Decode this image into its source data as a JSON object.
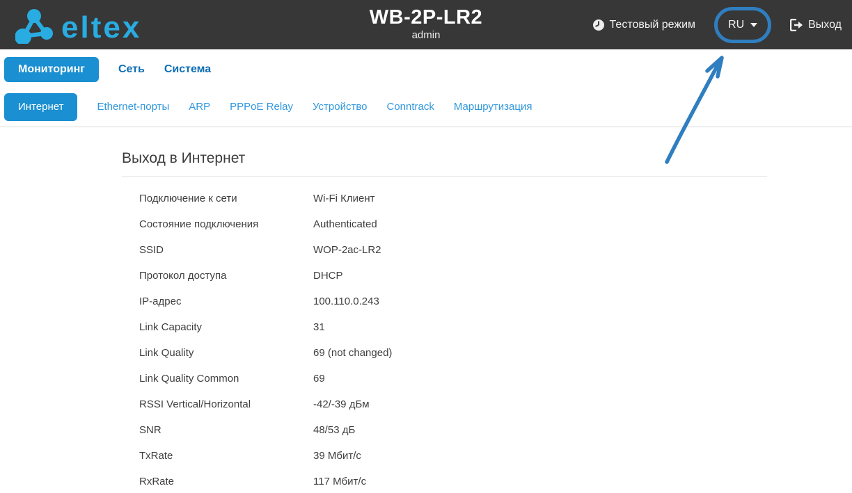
{
  "header": {
    "brand": "eltex",
    "title": "WB-2P-LR2",
    "subtitle": "admin",
    "test_mode_label": "Тестовый режим",
    "language_label": "RU",
    "logout_label": "Выход"
  },
  "nav": {
    "items": [
      {
        "label": "Мониторинг",
        "active": true
      },
      {
        "label": "Сеть",
        "active": false
      },
      {
        "label": "Система",
        "active": false
      }
    ]
  },
  "subnav": {
    "items": [
      {
        "label": "Интернет",
        "active": true
      },
      {
        "label": "Ethernet-порты",
        "active": false
      },
      {
        "label": "ARP",
        "active": false
      },
      {
        "label": "PPPoE Relay",
        "active": false
      },
      {
        "label": "Устройство",
        "active": false
      },
      {
        "label": "Conntrack",
        "active": false
      },
      {
        "label": "Маршрутизация",
        "active": false
      }
    ]
  },
  "main": {
    "heading": "Выход в Интернет",
    "rows": [
      {
        "label": "Подключение к сети",
        "value": "Wi-Fi Клиент"
      },
      {
        "label": "Состояние подключения",
        "value": "Authenticated"
      },
      {
        "label": "SSID",
        "value": "WOP-2ac-LR2"
      },
      {
        "label": "Протокол доступа",
        "value": "DHCP"
      },
      {
        "label": "IP-адрес",
        "value": "100.110.0.243"
      },
      {
        "label": "Link Capacity",
        "value": "31"
      },
      {
        "label": "Link Quality",
        "value": "69 (not changed)"
      },
      {
        "label": "Link Quality Common",
        "value": "69"
      },
      {
        "label": "RSSI Vertical/Horizontal",
        "value": "-42/-39 дБм"
      },
      {
        "label": "SNR",
        "value": "48/53 дБ"
      },
      {
        "label": "TxRate",
        "value": "39 Мбит/с"
      },
      {
        "label": "RxRate",
        "value": "117 Мбит/с"
      }
    ]
  },
  "annotation": {
    "target": "language-selector",
    "shapes": [
      "ellipse",
      "arrow"
    ],
    "color": "#2f7ec0"
  },
  "icons": {
    "test_mode": "clock-icon",
    "language": "chevron-down-icon",
    "logout": "logout-icon",
    "brand": "eltex-molecule-icon"
  },
  "colors": {
    "header_bg": "#373737",
    "brand_blue": "#29ace2",
    "active_tab": "#1a8fd1",
    "nav_link": "#0d6eb6",
    "subnav_link": "#2f97dd",
    "annotation": "#2f7ec0"
  }
}
